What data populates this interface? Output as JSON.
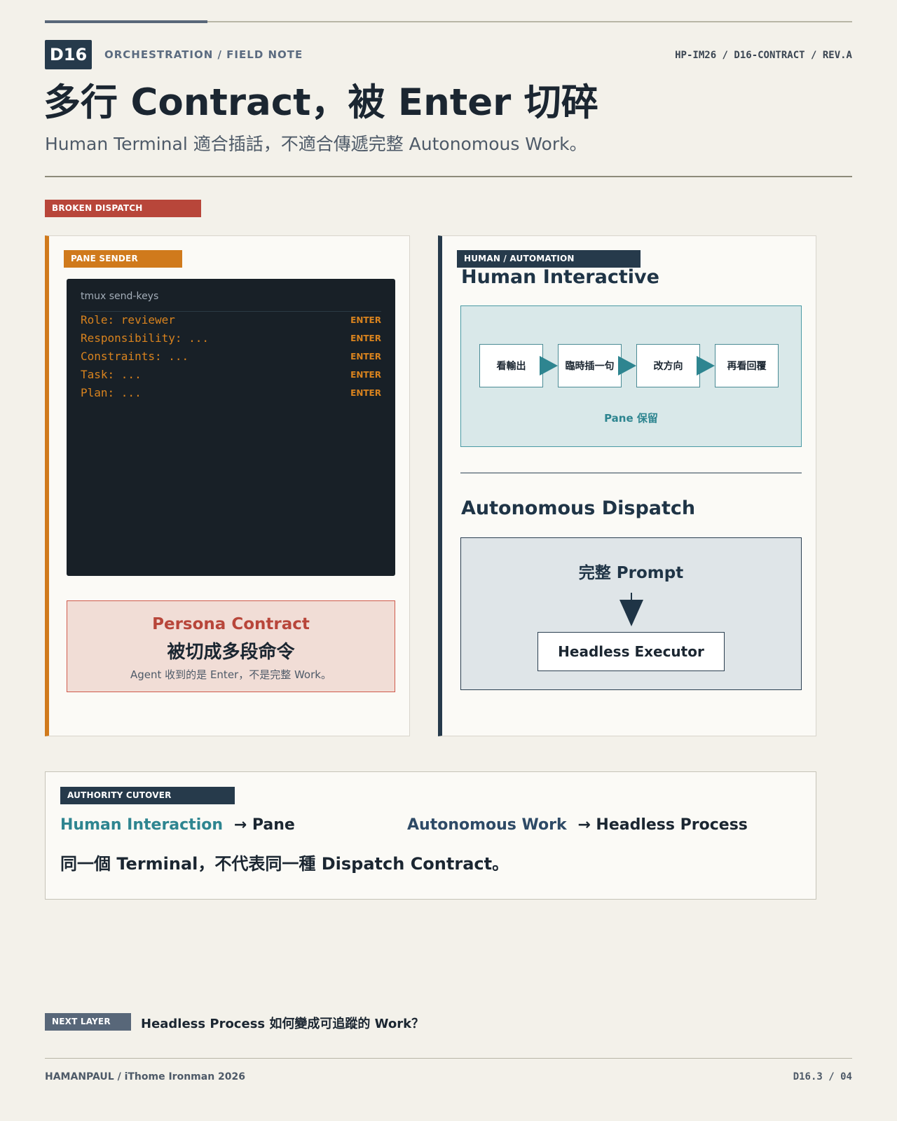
{
  "header": {
    "badge": "D16",
    "kicker": "ORCHESTRATION / FIELD NOTE",
    "ref": "HP-IM26 / D16-CONTRACT / REV.A",
    "title": "多行 Contract，被 Enter 切碎",
    "subtitle": "Human Terminal 適合插話，不適合傳遞完整 Autonomous Work。"
  },
  "section_tag": "BROKEN DISPATCH",
  "left_panel": {
    "tag": "PANE SENDER",
    "terminal": {
      "title": "tmux send-keys",
      "lines": [
        {
          "text": "Role: reviewer",
          "key": "ENTER"
        },
        {
          "text": "Responsibility: ...",
          "key": "ENTER"
        },
        {
          "text": "Constraints: ...",
          "key": "ENTER"
        },
        {
          "text": "Task: ...",
          "key": "ENTER"
        },
        {
          "text": "Plan: ...",
          "key": "ENTER"
        }
      ]
    },
    "callout": {
      "title": "Persona Contract",
      "headline": "被切成多段命令",
      "note": "Agent 收到的是 Enter，不是完整 Work。"
    }
  },
  "right_panel": {
    "tag": "HUMAN / AUTOMATION",
    "interactive": {
      "heading": "Human Interactive",
      "steps": [
        "看輸出",
        "臨時插一句",
        "改方向",
        "再看回覆"
      ],
      "caption": "Pane 保留"
    },
    "autonomous": {
      "heading": "Autonomous Dispatch",
      "source": "完整 Prompt",
      "target": "Headless Executor"
    }
  },
  "authority": {
    "tag": "AUTHORITY CUTOVER",
    "rows": [
      {
        "from": "Human Interaction",
        "arrow": "→",
        "to": "Pane"
      },
      {
        "from": "Autonomous Work",
        "arrow": "→",
        "to": "Headless Process"
      }
    ],
    "statement": "同一個 Terminal，不代表同一種 Dispatch Contract。"
  },
  "next_layer": {
    "tag": "NEXT LAYER",
    "text": "Headless Process 如何變成可追蹤的 Work？"
  },
  "footer": {
    "left": "HAMANPAUL / iThome Ironman 2026",
    "right": "D16.3 / 04"
  },
  "colors": {
    "background": "#f3f1ea",
    "navy": "#263a4b",
    "orange": "#d07a1c",
    "red": "#b8463a",
    "teal": "#2e8590",
    "terminal": "#182027"
  }
}
